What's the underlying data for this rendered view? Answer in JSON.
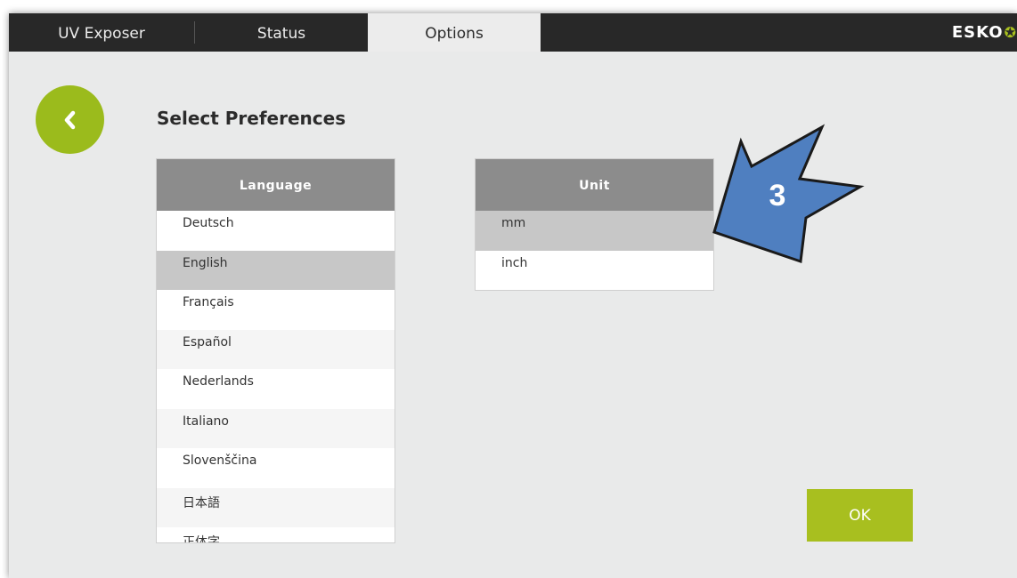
{
  "tabs": [
    {
      "label": "UV Exposer",
      "active": false
    },
    {
      "label": "Status",
      "active": false
    },
    {
      "label": "Options",
      "active": true
    }
  ],
  "brand": {
    "name": "ESKO",
    "icon": "esko-logo-icon"
  },
  "back_button": {
    "icon": "chevron-left-icon"
  },
  "page": {
    "title": "Select Preferences"
  },
  "language_list": {
    "header": "Language",
    "items": [
      "Deutsch",
      "English",
      "Français",
      "Español",
      "Nederlands",
      "Italiano",
      "Slovenščina",
      "日本語",
      "正体字"
    ],
    "selected": "English"
  },
  "unit_list": {
    "header": "Unit",
    "items": [
      "mm",
      "inch"
    ],
    "selected": "mm"
  },
  "callout": {
    "label": "3",
    "icon": "arrow-pointer-icon"
  },
  "ok_button": {
    "label": "OK"
  },
  "colors": {
    "accent": "#a8bf1f",
    "back_button": "#9bbb1c",
    "tabbar": "#282828",
    "background": "#e9eaea",
    "list_header": "#8c8c8c",
    "selected_row": "#c7c7c7",
    "callout_arrow": "#4f7fc0"
  }
}
